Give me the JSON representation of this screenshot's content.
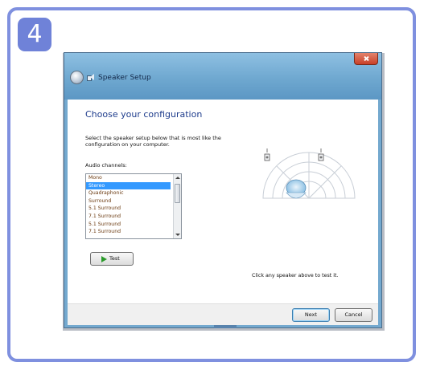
{
  "step": {
    "number": "4"
  },
  "window": {
    "title": "Speaker Setup"
  },
  "page": {
    "heading": "Choose your configuration",
    "description": "Select the speaker setup below that is most like the configuration on your computer.",
    "audio_channels_label": "Audio channels:"
  },
  "channels": [
    {
      "label": "Mono",
      "selected": false
    },
    {
      "label": "Stereo",
      "selected": true
    },
    {
      "label": "Quadraphonic",
      "selected": false
    },
    {
      "label": "Surround",
      "selected": false
    },
    {
      "label": "5.1 Surround",
      "selected": false
    },
    {
      "label": "7.1 Surround",
      "selected": false
    },
    {
      "label": "5.1 Surround",
      "selected": false
    },
    {
      "label": "7.1 Surround",
      "selected": false
    }
  ],
  "buttons": {
    "test": "Test",
    "next": "Next",
    "cancel": "Cancel"
  },
  "hint": "Click any speaker above to test it.",
  "colors": {
    "frame": "#7f90df",
    "badge": "#6f82d8",
    "selection": "#3399ff",
    "heading": "#1e3c8c"
  },
  "icons": {
    "back": "back-arrow-icon",
    "app": "speaker-icon",
    "close": "close-icon",
    "test": "play-icon"
  }
}
